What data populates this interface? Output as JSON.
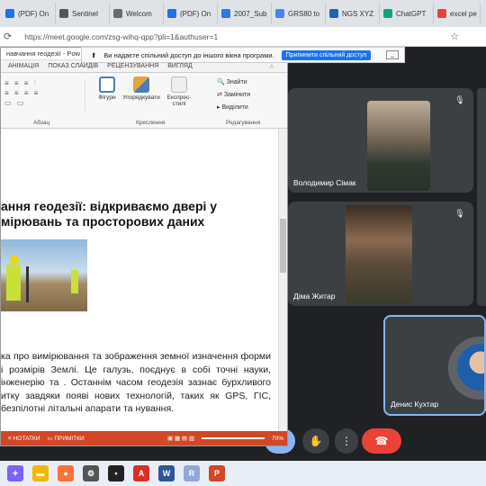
{
  "browser": {
    "tabs": [
      {
        "label": "(PDF) On",
        "color": "#1a73e8",
        "icon": "researchgate-icon"
      },
      {
        "label": "Sentinel",
        "color": "#555555",
        "icon": "page-icon"
      },
      {
        "label": "Welcom",
        "color": "#6b6b6b",
        "icon": "page-icon"
      },
      {
        "label": "(PDF) On",
        "color": "#1a73e8",
        "icon": "researchgate-icon"
      },
      {
        "label": "2007_Sub",
        "color": "#2a7ae2",
        "icon": "doc-icon"
      },
      {
        "label": "GRS80 to",
        "color": "#4285f4",
        "icon": "google-icon"
      },
      {
        "label": "NGS XYZ",
        "color": "#1565c0",
        "icon": "globe-icon"
      },
      {
        "label": "ChatGPT",
        "color": "#10a37f",
        "icon": "chatgpt-icon"
      },
      {
        "label": "excel pe",
        "color": "#ea4335",
        "icon": "google-icon"
      }
    ],
    "url": "https://meet.google.com/zsg-wihq-qpp?pli=1&authuser=1"
  },
  "share_banner": {
    "text": "Ви надаєте спільний доступ до іншого вікна програми.",
    "stop_label": "Припинити спільний доступ"
  },
  "ppt": {
    "title": "навчання геодезії - Pow",
    "ribbon_tabs": [
      "АНІМАЦІЯ",
      "ПОКАЗ СЛАЙДІВ",
      "РЕЦЕНЗУВАННЯ",
      "ВИГЛЯД"
    ],
    "groups": {
      "paragraph": "Абзац",
      "drawing": "Креслення",
      "editing": "Редагування"
    },
    "buttons": {
      "shapes": "Фігури",
      "arrange": "Упорядкувати",
      "quick_styles": "Експрес-стилі",
      "find": "Знайти",
      "replace": "Замінити",
      "select": "Виділити"
    },
    "slide_title": "ання геодезії: відкриваємо двері у мірювань та просторових даних",
    "slide_body": "ка про вимірювання та зображення земної изначення форми і розмірів Землі. Це галузь, поєднує в собі точні науки, інженерію та . Останнім часом геодезія зазнає бурхливого итку завдяки появі нових технологій, таких як GPS, ГІС, безпілотні літальні апарати та нування.",
    "status": {
      "notes": "НОТАТКИ",
      "comments": "ПРИМІТКИ",
      "zoom": "70%"
    }
  },
  "meet": {
    "participants": [
      {
        "name": "Володимир Сімак",
        "muted": true
      },
      {
        "name": "Діма Житар",
        "muted": true
      },
      {
        "name": "Денис Кухтар",
        "muted": false
      }
    ]
  },
  "taskbar": {
    "apps": [
      {
        "icon": "copilot-icon",
        "color": "#7b61ff",
        "glyph": "✦"
      },
      {
        "icon": "file-explorer-icon",
        "color": "#f2b705",
        "glyph": "▬"
      },
      {
        "icon": "firefox-icon",
        "color": "#ff7139",
        "glyph": "●"
      },
      {
        "icon": "settings-icon",
        "color": "#555555",
        "glyph": "⚙"
      },
      {
        "icon": "sticky-notes-icon",
        "color": "#222222",
        "glyph": "▪"
      },
      {
        "icon": "pdf-icon",
        "color": "#d93025",
        "glyph": "A"
      },
      {
        "icon": "word-icon",
        "color": "#2b579a",
        "glyph": "W"
      },
      {
        "icon": "r-icon",
        "color": "#8fa9d6",
        "glyph": "R"
      },
      {
        "icon": "powerpoint-icon",
        "color": "#d24726",
        "glyph": "P"
      }
    ]
  }
}
